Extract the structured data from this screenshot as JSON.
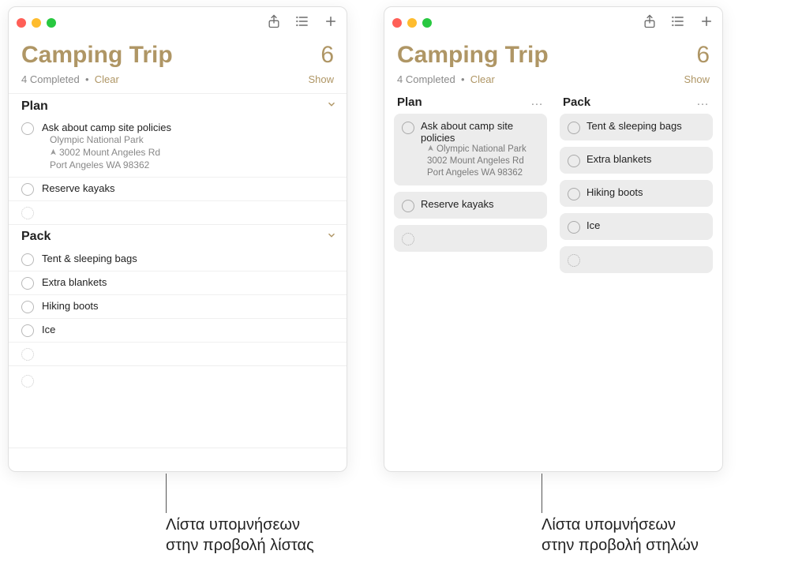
{
  "list_title": "Camping Trip",
  "count": "6",
  "completed_text": "4 Completed",
  "dot": "•",
  "clear_label": "Clear",
  "show_label": "Show",
  "sections": {
    "plan": {
      "name": "Plan",
      "more": "…",
      "items": [
        {
          "title": "Ask about camp site policies",
          "location_name": "Olympic National Park",
          "address1": "3002 Mount Angeles Rd",
          "address2": "Port Angeles WA 98362"
        },
        {
          "title": "Reserve kayaks"
        }
      ]
    },
    "pack": {
      "name": "Pack",
      "more": "…",
      "items": [
        {
          "title": "Tent & sleeping bags"
        },
        {
          "title": "Extra blankets"
        },
        {
          "title": "Hiking boots"
        },
        {
          "title": "Ice"
        }
      ]
    }
  },
  "captions": {
    "left_line1": "Λίστα υπομνήσεων",
    "left_line2": "στην προβολή λίστας",
    "right_line1": "Λίστα υπομνήσεων",
    "right_line2": "στην προβολή στηλών"
  }
}
